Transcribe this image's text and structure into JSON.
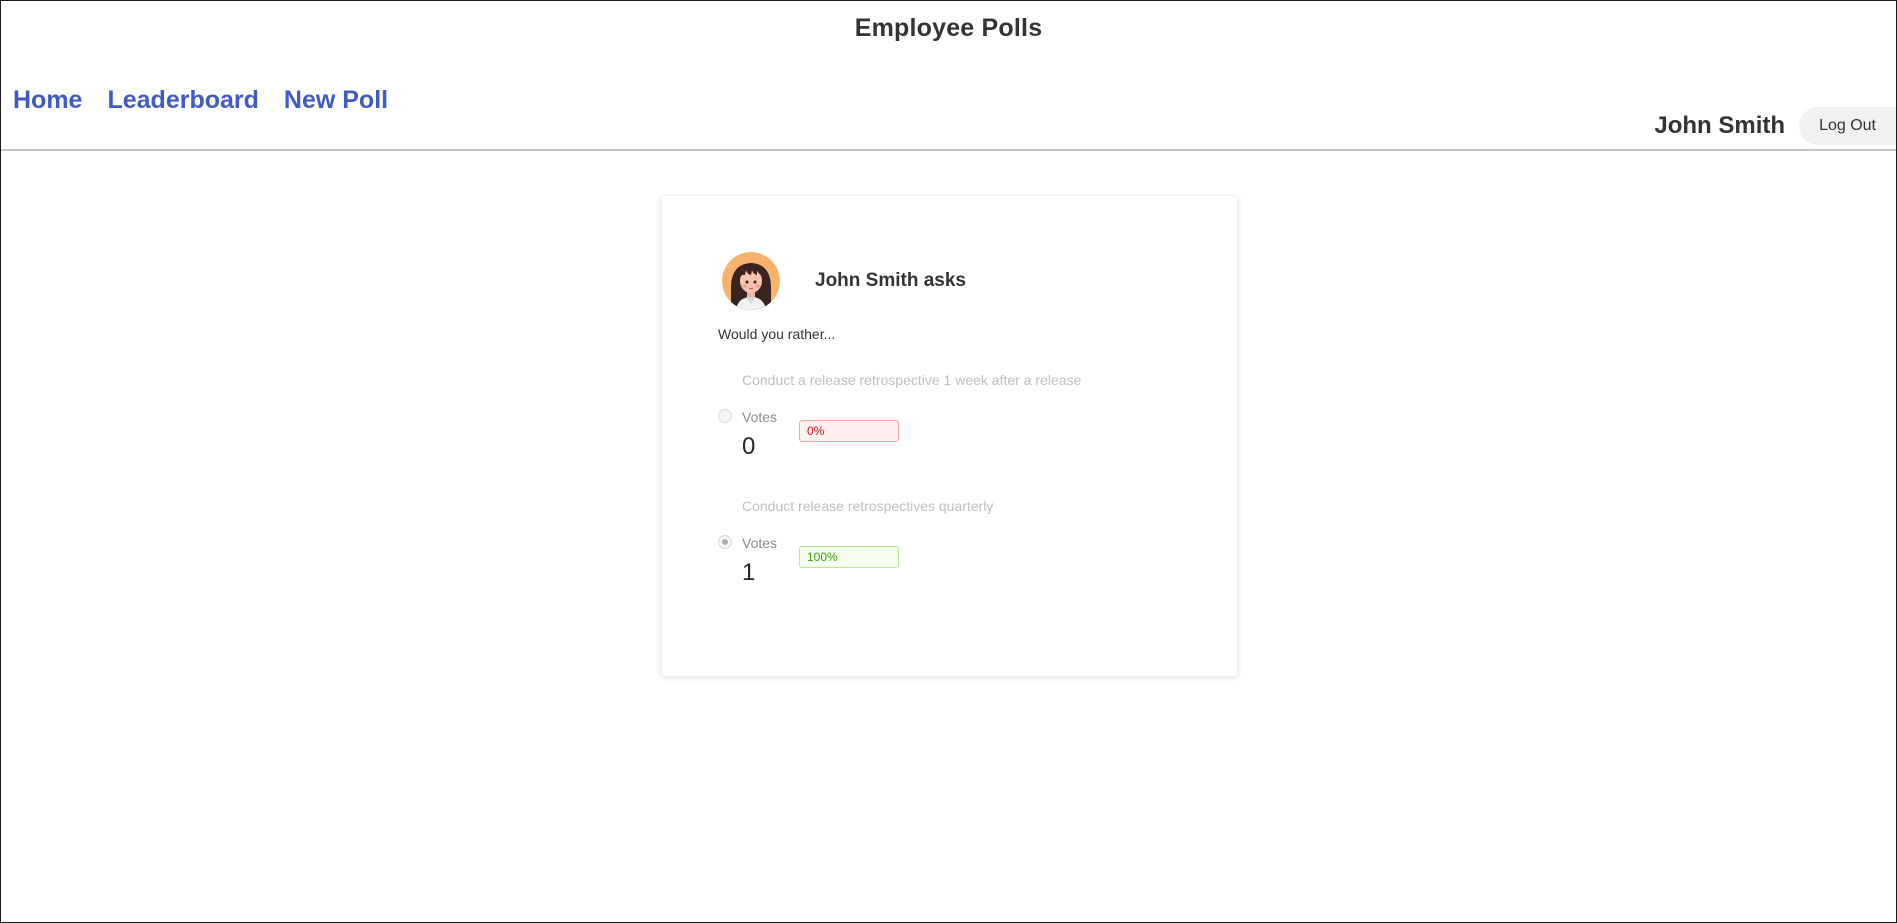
{
  "header": {
    "title": "Employee Polls"
  },
  "nav": {
    "home": "Home",
    "leaderboard": "Leaderboard",
    "new_poll": "New Poll"
  },
  "user": {
    "name": "John Smith",
    "logout_label": "Log Out"
  },
  "poll": {
    "author_label": "John Smith asks",
    "avatar_icon": "female-avatar-icon",
    "prompt": "Would you rather...",
    "options": [
      {
        "text": "Conduct a release retrospective 1 week after a release",
        "votes_label": "Votes",
        "votes": "0",
        "percent": "0%",
        "selected": false,
        "tag_color": "#cf1322"
      },
      {
        "text": "Conduct release retrospectives quarterly",
        "votes_label": "Votes",
        "votes": "1",
        "percent": "100%",
        "selected": true,
        "tag_color": "#389e0d"
      }
    ]
  },
  "colors": {
    "nav_link": "#3f5bc4",
    "avatar_background": "#f7b36b"
  }
}
